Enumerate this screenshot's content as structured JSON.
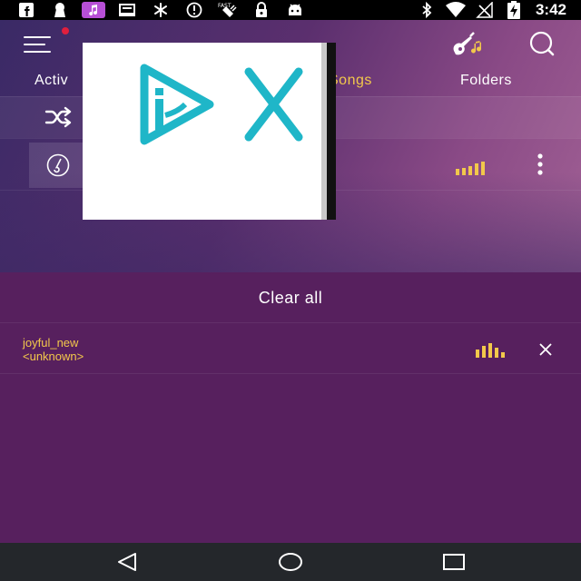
{
  "status_bar": {
    "time": "3:42",
    "left_icons": [
      "facebook-icon",
      "keyhole-icon",
      "music-note-icon",
      "cast-icon",
      "fan-icon",
      "info-icon",
      "satellite-fast-icon",
      "lock-icon",
      "android-icon"
    ],
    "right_icons": [
      "bluetooth-icon",
      "wifi-icon",
      "no-signal-icon",
      "battery-charging-icon"
    ]
  },
  "header": {
    "menu_icon": "menu-icon",
    "guitar_icon": "guitar-icon",
    "search_icon": "search-icon",
    "notification_dot_color": "#e01f3d"
  },
  "tabs": [
    {
      "label": "Activ",
      "active": false
    },
    {
      "label": "Songs",
      "active": true
    },
    {
      "label": "Folders",
      "active": false
    }
  ],
  "colors": {
    "accent": "#f2c84b",
    "queue_bg": "#57205e",
    "nav_bg": "#24272b"
  },
  "overlay_ad": {
    "icons": [
      "play-logo-icon",
      "close-x-icon"
    ],
    "color": "#1fb6c8"
  },
  "queue": {
    "clear_all_label": "Clear all",
    "items": [
      {
        "title": "joyful_new",
        "artist": "<unknown>"
      }
    ]
  },
  "nav": {
    "icons": [
      "back-icon",
      "home-icon",
      "recents-icon"
    ]
  }
}
